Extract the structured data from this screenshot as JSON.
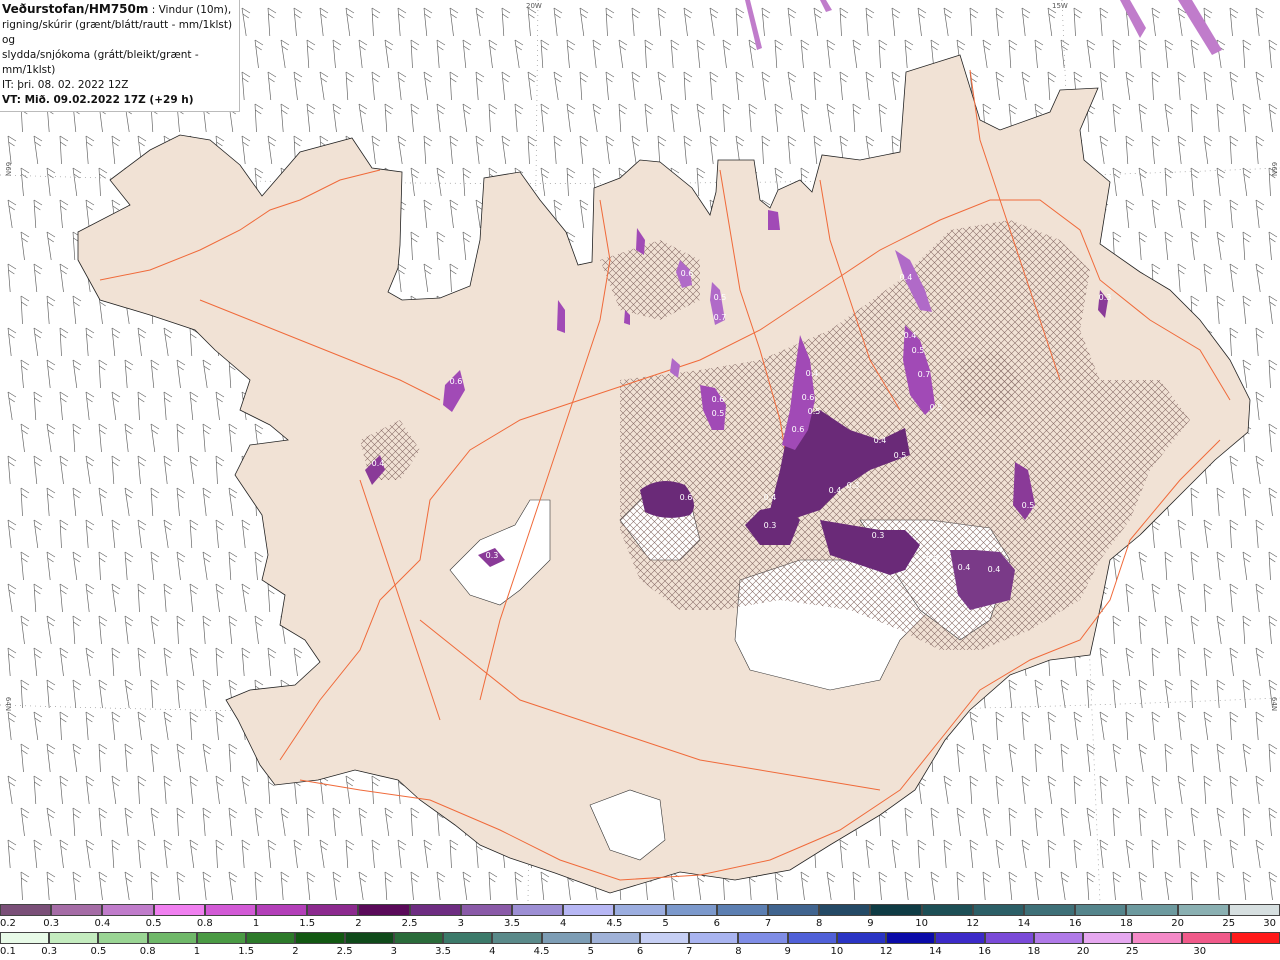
{
  "header": {
    "title_bold": "Veðurstofan/HM750m",
    "title_rest": " : Vindur (10m),",
    "line2": "rigning/skúrir (grænt/blátt/rautt - mm/1klst) og",
    "line3": "slydda/snjókoma (grátt/bleikt/grænt - mm/1klst)",
    "line4": "IT: þri. 08. 02. 2022 12Z",
    "line5": "VT: Mið. 09.02.2022 17Z (+29 h)"
  },
  "grid_labels": {
    "lon_20w": "20W",
    "lon_15w": "15W",
    "lat_66n_left": "66N",
    "lat_66n_right": "66N",
    "lat_64n_left": "64N",
    "lat_64n_right": "64N"
  },
  "precip_labels": [
    "0.6",
    "0.5",
    "0.7",
    "0.6",
    "0.5",
    "0.4",
    "0.6",
    "0.5",
    "0.6",
    "0.6",
    "0.5",
    "0.7",
    "0.4",
    "0.4",
    "0.5",
    "0.3",
    "0.4",
    "0.4",
    "0.3",
    "0.3",
    "0.3",
    "0.4",
    "0.4",
    "0.6",
    "0.5",
    "0.3",
    "0.4",
    "0.3",
    "0.4",
    "0.5"
  ],
  "legend_snow": {
    "colors": [
      "#7a4f78",
      "#a56ca6",
      "#c07ccb",
      "#f080f0",
      "#d25ad6",
      "#b33fb9",
      "#8c2a8f",
      "#5a0a5a",
      "#6e2d82",
      "#8a5aa8",
      "#9d8fd4",
      "#b7b7f4",
      "#9caee0",
      "#7c99cc",
      "#5c7fb2",
      "#40648f",
      "#244a66",
      "#0f3c45",
      "#1d4f56",
      "#2c5f67",
      "#3e7078",
      "#55858c",
      "#6d9a9f",
      "#8ab0b2",
      "#d6dfe0"
    ],
    "labels": [
      "0.2",
      "0.3",
      "0.4",
      "0.5",
      "0.8",
      "1",
      "1.5",
      "2",
      "2.5",
      "3",
      "3.5",
      "4",
      "4.5",
      "5",
      "6",
      "7",
      "8",
      "9",
      "10",
      "12",
      "14",
      "16",
      "18",
      "20",
      "25",
      "30"
    ]
  },
  "legend_rain": {
    "colors": [
      "#e8fbe8",
      "#c4ecbf",
      "#9ad594",
      "#6fb869",
      "#4a9a44",
      "#2d7a2a",
      "#125812",
      "#0f4a1a",
      "#2a6b3a",
      "#3c7a6a",
      "#5a8a8a",
      "#7d9db5",
      "#a0b2d8",
      "#c6cff4",
      "#a9b4f0",
      "#7f8de6",
      "#5060d8",
      "#2a34c4",
      "#0a0aa8",
      "#3c2ac8",
      "#7a4ad8",
      "#b07ae8",
      "#e6a8f0",
      "#f58ac8",
      "#f05a8a",
      "#ff1a1a"
    ],
    "labels": [
      "0.1",
      "0.3",
      "0.5",
      "0.8",
      "1",
      "1.5",
      "2",
      "2.5",
      "3",
      "3.5",
      "4",
      "4.5",
      "5",
      "6",
      "7",
      "8",
      "9",
      "10",
      "12",
      "14",
      "16",
      "18",
      "20",
      "25",
      "30"
    ]
  },
  "colors": {
    "land": "#f1e2d5",
    "road": "#f06a3a",
    "hatch": "#8a6f6a",
    "precip_light": "#b86ad0",
    "precip_dark": "#6a2a78",
    "glacier": "#ffffff"
  }
}
